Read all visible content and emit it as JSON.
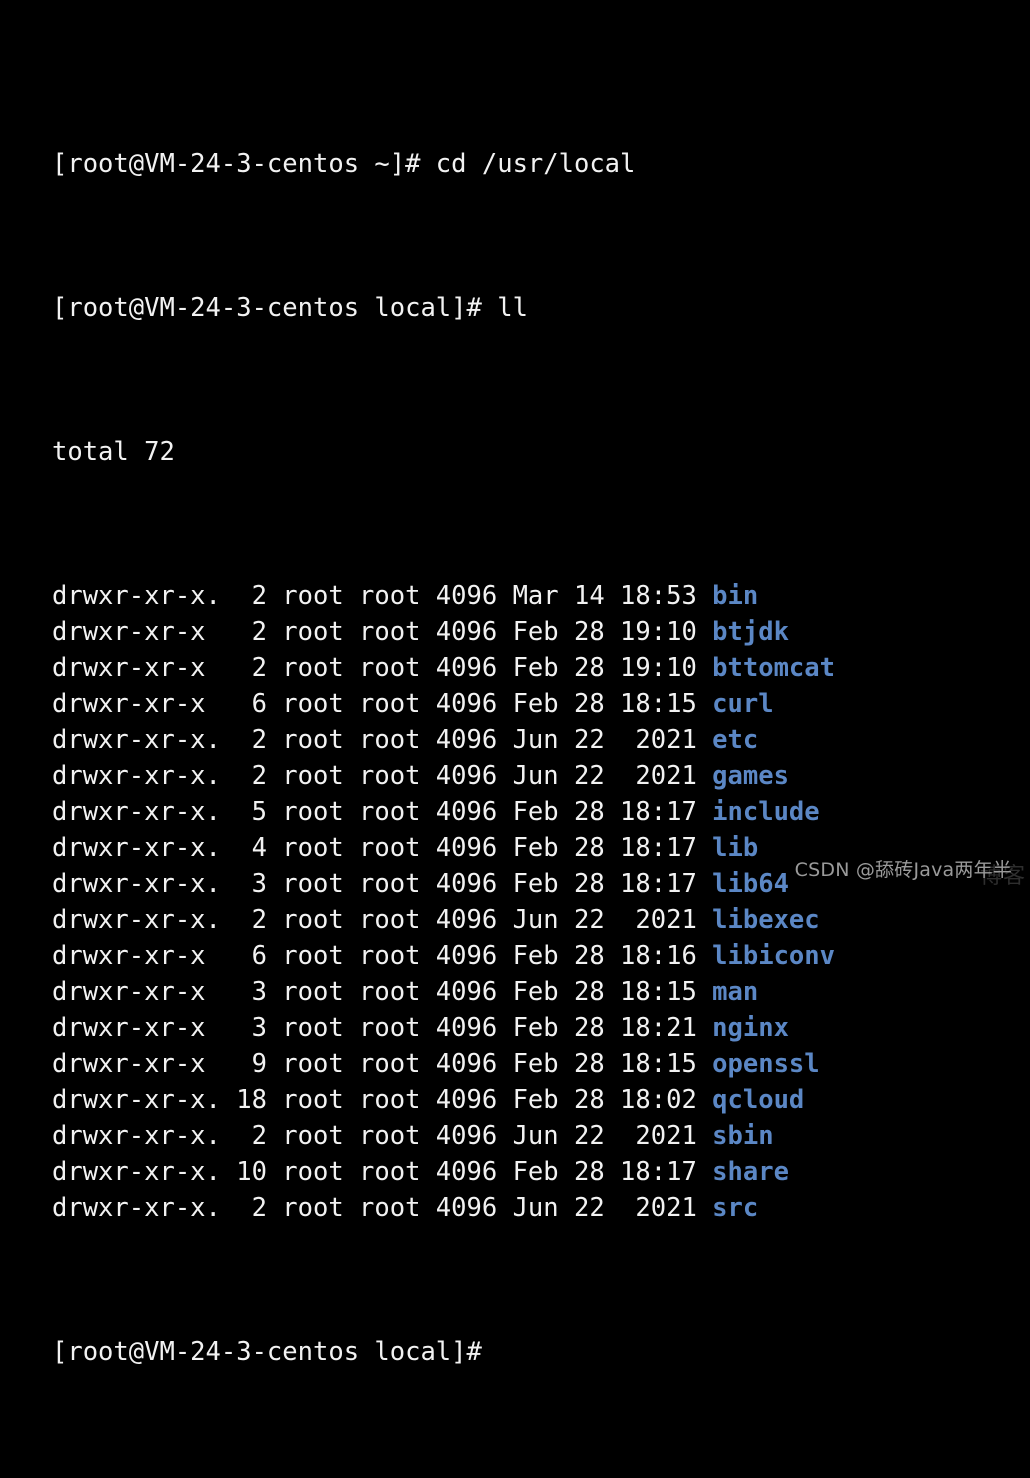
{
  "terminal": {
    "background_color": "#000000",
    "foreground_color": "#f2f2f2",
    "dirname_color": "#5b87c5",
    "lines": [
      {
        "type": "prompt",
        "text": "[root@VM-24-3-centos ~]# cd /usr/local"
      },
      {
        "type": "prompt",
        "text": "[root@VM-24-3-centos local]# ll"
      },
      {
        "type": "plain",
        "text": "total 72"
      }
    ],
    "total_line": "total 72",
    "prompt_cd": "[root@VM-24-3-centos ~]# cd /usr/local",
    "prompt_ll": "[root@VM-24-3-centos local]# ll",
    "prompt_final": "[root@VM-24-3-centos local]#",
    "listing_columns": [
      "permissions",
      "links",
      "owner",
      "group",
      "size",
      "month",
      "day",
      "time",
      "name"
    ],
    "listing": [
      {
        "perms": "drwxr-xr-x.",
        "links": "2",
        "owner": "root",
        "group": "root",
        "size": "4096",
        "month": "Mar",
        "day": "14",
        "time": "18:53",
        "name": "bin"
      },
      {
        "perms": "drwxr-xr-x",
        "links": "2",
        "owner": "root",
        "group": "root",
        "size": "4096",
        "month": "Feb",
        "day": "28",
        "time": "19:10",
        "name": "btjdk"
      },
      {
        "perms": "drwxr-xr-x",
        "links": "2",
        "owner": "root",
        "group": "root",
        "size": "4096",
        "month": "Feb",
        "day": "28",
        "time": "19:10",
        "name": "bttomcat"
      },
      {
        "perms": "drwxr-xr-x",
        "links": "6",
        "owner": "root",
        "group": "root",
        "size": "4096",
        "month": "Feb",
        "day": "28",
        "time": "18:15",
        "name": "curl"
      },
      {
        "perms": "drwxr-xr-x.",
        "links": "2",
        "owner": "root",
        "group": "root",
        "size": "4096",
        "month": "Jun",
        "day": "22",
        "time": "2021",
        "name": "etc"
      },
      {
        "perms": "drwxr-xr-x.",
        "links": "2",
        "owner": "root",
        "group": "root",
        "size": "4096",
        "month": "Jun",
        "day": "22",
        "time": "2021",
        "name": "games"
      },
      {
        "perms": "drwxr-xr-x.",
        "links": "5",
        "owner": "root",
        "group": "root",
        "size": "4096",
        "month": "Feb",
        "day": "28",
        "time": "18:17",
        "name": "include"
      },
      {
        "perms": "drwxr-xr-x.",
        "links": "4",
        "owner": "root",
        "group": "root",
        "size": "4096",
        "month": "Feb",
        "day": "28",
        "time": "18:17",
        "name": "lib"
      },
      {
        "perms": "drwxr-xr-x.",
        "links": "3",
        "owner": "root",
        "group": "root",
        "size": "4096",
        "month": "Feb",
        "day": "28",
        "time": "18:17",
        "name": "lib64"
      },
      {
        "perms": "drwxr-xr-x.",
        "links": "2",
        "owner": "root",
        "group": "root",
        "size": "4096",
        "month": "Jun",
        "day": "22",
        "time": "2021",
        "name": "libexec"
      },
      {
        "perms": "drwxr-xr-x",
        "links": "6",
        "owner": "root",
        "group": "root",
        "size": "4096",
        "month": "Feb",
        "day": "28",
        "time": "18:16",
        "name": "libiconv"
      },
      {
        "perms": "drwxr-xr-x",
        "links": "3",
        "owner": "root",
        "group": "root",
        "size": "4096",
        "month": "Feb",
        "day": "28",
        "time": "18:15",
        "name": "man"
      },
      {
        "perms": "drwxr-xr-x",
        "links": "3",
        "owner": "root",
        "group": "root",
        "size": "4096",
        "month": "Feb",
        "day": "28",
        "time": "18:21",
        "name": "nginx"
      },
      {
        "perms": "drwxr-xr-x",
        "links": "9",
        "owner": "root",
        "group": "root",
        "size": "4096",
        "month": "Feb",
        "day": "28",
        "time": "18:15",
        "name": "openssl"
      },
      {
        "perms": "drwxr-xr-x.",
        "links": "18",
        "owner": "root",
        "group": "root",
        "size": "4096",
        "month": "Feb",
        "day": "28",
        "time": "18:02",
        "name": "qcloud"
      },
      {
        "perms": "drwxr-xr-x.",
        "links": "2",
        "owner": "root",
        "group": "root",
        "size": "4096",
        "month": "Jun",
        "day": "22",
        "time": "2021",
        "name": "sbin"
      },
      {
        "perms": "drwxr-xr-x.",
        "links": "10",
        "owner": "root",
        "group": "root",
        "size": "4096",
        "month": "Feb",
        "day": "28",
        "time": "18:17",
        "name": "share"
      },
      {
        "perms": "drwxr-xr-x.",
        "links": "2",
        "owner": "root",
        "group": "root",
        "size": "4096",
        "month": "Jun",
        "day": "22",
        "time": "2021",
        "name": "src"
      }
    ]
  },
  "watermark": {
    "text": "CSDN @舔砖Java两年半",
    "ghost_text": "博客"
  }
}
